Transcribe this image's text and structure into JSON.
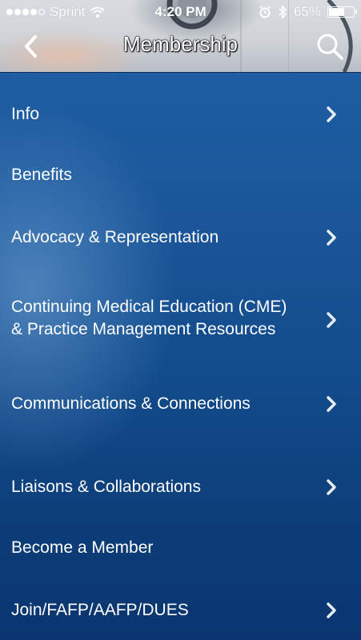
{
  "status_bar": {
    "carrier": "Sprint",
    "time": "4:20 PM",
    "battery_percent": "65%",
    "battery_level": 0.65,
    "signal_dots_filled": 4,
    "signal_dots_total": 5
  },
  "nav": {
    "title": "Membership",
    "back_icon": "chevron-left-icon",
    "search_icon": "search-icon"
  },
  "menu": {
    "items": [
      {
        "label": "Info",
        "has_chevron": true
      },
      {
        "label": "Benefits",
        "has_chevron": false
      },
      {
        "label": "Advocacy & Representation",
        "has_chevron": true
      },
      {
        "label_line1": "Continuing Medical Education (CME)",
        "label_line2": "& Practice Management Resources",
        "has_chevron": true
      },
      {
        "label": "Communications & Connections",
        "has_chevron": true
      },
      {
        "label": "Liaisons & Collaborations",
        "has_chevron": true
      },
      {
        "label": "Become a Member",
        "has_chevron": false
      },
      {
        "label": "Join/FAFP/AAFP/DUES",
        "has_chevron": true
      }
    ]
  },
  "colors": {
    "menu_background": "#124b8b",
    "text": "#ffffff"
  }
}
